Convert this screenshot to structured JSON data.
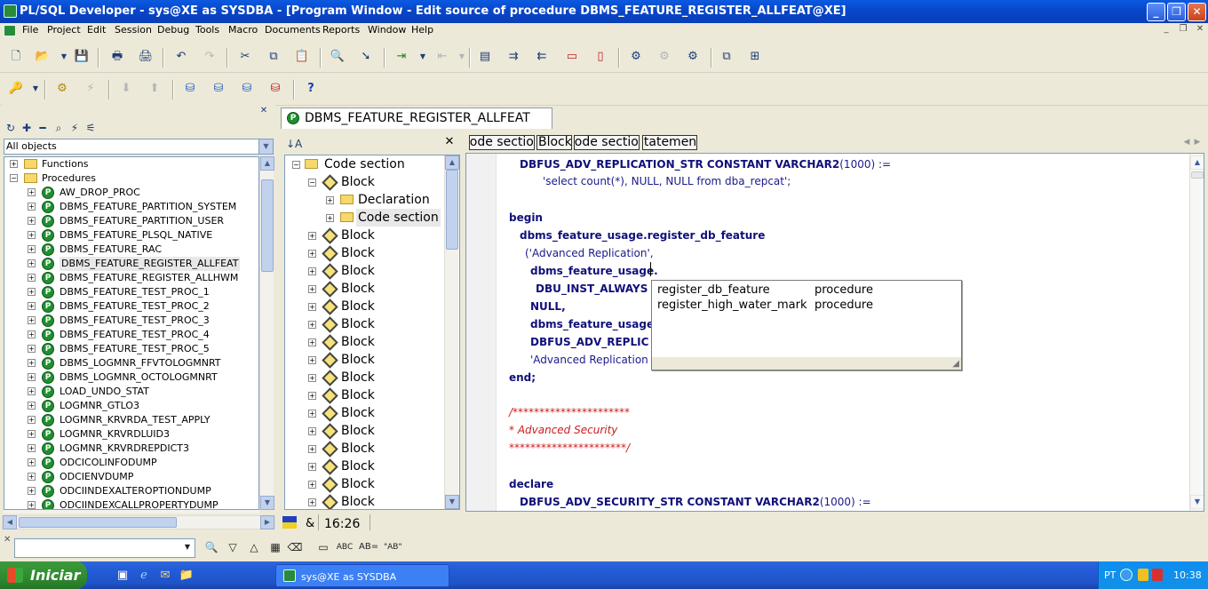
{
  "window": {
    "title": "PL/SQL Developer - sys@XE as SYSDBA - [Program Window - Edit source of procedure DBMS_FEATURE_REGISTER_ALLFEAT@XE]"
  },
  "menu": [
    "File",
    "Project",
    "Edit",
    "Session",
    "Debug",
    "Tools",
    "Macro",
    "Documents",
    "Reports",
    "Window",
    "Help"
  ],
  "browser": {
    "filter": "All objects",
    "folders": [
      "Functions",
      "Procedures"
    ],
    "procedures": [
      "AW_DROP_PROC",
      "DBMS_FEATURE_PARTITION_SYSTEM",
      "DBMS_FEATURE_PARTITION_USER",
      "DBMS_FEATURE_PLSQL_NATIVE",
      "DBMS_FEATURE_RAC",
      "DBMS_FEATURE_REGISTER_ALLFEAT",
      "DBMS_FEATURE_REGISTER_ALLHWM",
      "DBMS_FEATURE_TEST_PROC_1",
      "DBMS_FEATURE_TEST_PROC_2",
      "DBMS_FEATURE_TEST_PROC_3",
      "DBMS_FEATURE_TEST_PROC_4",
      "DBMS_FEATURE_TEST_PROC_5",
      "DBMS_LOGMNR_FFVTOLOGMNRT",
      "DBMS_LOGMNR_OCTOLOGMNRT",
      "LOAD_UNDO_STAT",
      "LOGMNR_GTLO3",
      "LOGMNR_KRVRDA_TEST_APPLY",
      "LOGMNR_KRVRDLUID3",
      "LOGMNR_KRVRDREPDICT3",
      "ODCICOLINFODUMP",
      "ODCIENVDUMP",
      "ODCIINDEXALTEROPTIONDUMP",
      "ODCIINDEXCALLPROPERTYDUMP"
    ],
    "selected": "DBMS_FEATURE_REGISTER_ALLFEAT"
  },
  "tab": {
    "label": "DBMS_FEATURE_REGISTER_ALLFEAT"
  },
  "code_tree": {
    "root": "Code section",
    "first_block": "Block",
    "children": [
      "Declaration",
      "Code section"
    ],
    "block_label": "Block",
    "block_count": 16
  },
  "nav_buttons": [
    "Code section",
    "Block",
    "Code section",
    "Statement"
  ],
  "code": {
    "l1": "DBFUS_ADV_REPLICATION_STR CONSTANT VARCHAR2",
    "l1b": "(1000) :=",
    "l2": "'select count(*), NULL, NULL from dba_repcat';",
    "l3": "begin",
    "l4": "dbms_feature_usage.register_db_feature",
    "l5": "('Advanced Replication',",
    "l6": "dbms_feature_usage.",
    "l7": "DBU_INST_ALWAYS",
    "l8": "NULL,",
    "l9": "dbms_feature_usage.",
    "l10": "DBFUS_ADV_REPLIC",
    "l11": "'Advanced Replication",
    "l12": "end;",
    "c1": "/**********************",
    "c2": "* Advanced Security",
    "c3": "**********************/",
    "l13": "declare",
    "l14": "DBFUS_ADV_SECURITY_STR CONSTANT VARCHAR2",
    "l14b": "(1000) :="
  },
  "autocomplete": [
    {
      "name": "register_db_feature",
      "type": "procedure"
    },
    {
      "name": "register_high_water_mark",
      "type": "procedure"
    }
  ],
  "status": {
    "symbol": "&",
    "position": "16:26"
  },
  "taskbar": {
    "start": "Iniciar",
    "task": "sys@XE as SYSDBA",
    "lang": "PT",
    "clock": "10:38"
  },
  "findbar": {
    "abc": "ABC",
    "ab": "\"AB\""
  }
}
